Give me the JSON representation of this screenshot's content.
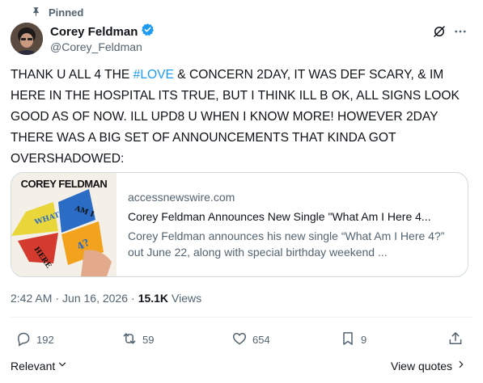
{
  "pinned": {
    "label": "Pinned",
    "icon": "pin-icon"
  },
  "author": {
    "display_name": "Corey Feldman",
    "handle": "@Corey_Feldman",
    "verified": true,
    "verified_color": "#1d9bf0"
  },
  "tweet": {
    "text_before": "THANK U ALL 4 THE ",
    "hashtag": "#LOVE",
    "text_after": " & CONCERN 2DAY, IT WAS DEF SCARY, & IM HERE IN THE HOSPITAL ITS TRUE, BUT I THINK ILL B OK, ALL SIGNS LOOK GOOD AS OF NOW. ILL UPD8 U WHEN I KNOW MORE! HOWEVER 2DAY THERE WAS A BIG SET OF ANNOUNCEMENTS THAT KINDA GOT OVERSHADOWED:"
  },
  "link_card": {
    "image_text": {
      "artist": "COREY FELDMAN",
      "flap1": "WHAT",
      "flap2": "AM I",
      "flap3": "HERE",
      "flap4": "4?"
    },
    "domain": "accessnewswire.com",
    "title": "Corey Feldman Announces New Single \"What Am I Here 4...",
    "description": "Corey Feldman announces his new single “What Am I Here 4?” out June 22, along with special birthday weekend ..."
  },
  "meta": {
    "time": "2:42 AM",
    "separator": "·",
    "date": "Jun 16, 2026",
    "views_count": "15.1K",
    "views_label": "Views"
  },
  "actions": {
    "replies": "192",
    "reposts": "59",
    "likes": "654",
    "bookmarks": "9"
  },
  "footer": {
    "relevant_label": "Relevant",
    "view_quotes_label": "View quotes"
  },
  "colors": {
    "accent": "#1d9bf0",
    "secondary_text": "#536471",
    "primary_text": "#0f1419",
    "border": "#cfd9de"
  }
}
